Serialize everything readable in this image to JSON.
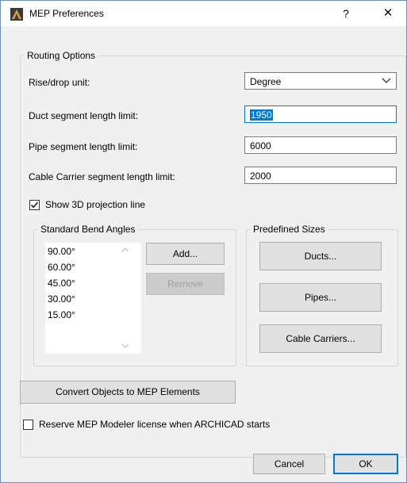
{
  "window": {
    "title": "MEP Preferences",
    "help": "?",
    "close": "×"
  },
  "routing": {
    "legend": "Routing Options",
    "rise_drop_label": "Rise/drop unit:",
    "rise_drop_value": "Degree",
    "duct_label": "Duct segment length limit:",
    "duct_value": "1950",
    "pipe_label": "Pipe segment length limit:",
    "pipe_value": "6000",
    "cable_label": "Cable Carrier segment length limit:",
    "cable_value": "2000",
    "show_projection_label": "Show 3D projection line",
    "show_projection_checked": true
  },
  "bend_angles": {
    "legend": "Standard Bend Angles",
    "items": [
      "90.00°",
      "60.00°",
      "45.00°",
      "30.00°",
      "15.00°"
    ],
    "add_label": "Add...",
    "remove_label": "Remove"
  },
  "predefined": {
    "legend": "Predefined Sizes",
    "ducts_label": "Ducts...",
    "pipes_label": "Pipes...",
    "cable_carriers_label": "Cable Carriers..."
  },
  "convert_label": "Convert Objects to MEP Elements",
  "reserve": {
    "label": "Reserve MEP Modeler license when ARCHICAD starts",
    "checked": false
  },
  "footer": {
    "cancel_label": "Cancel",
    "ok_label": "OK"
  },
  "colors": {
    "accent": "#0078d7",
    "dialog_bg": "#f0f0f0",
    "button_bg": "#e1e1e1"
  },
  "icons": {
    "app": "archicad-app-icon",
    "dropdown": "chevron-down-icon",
    "check": "checkmark-icon"
  }
}
